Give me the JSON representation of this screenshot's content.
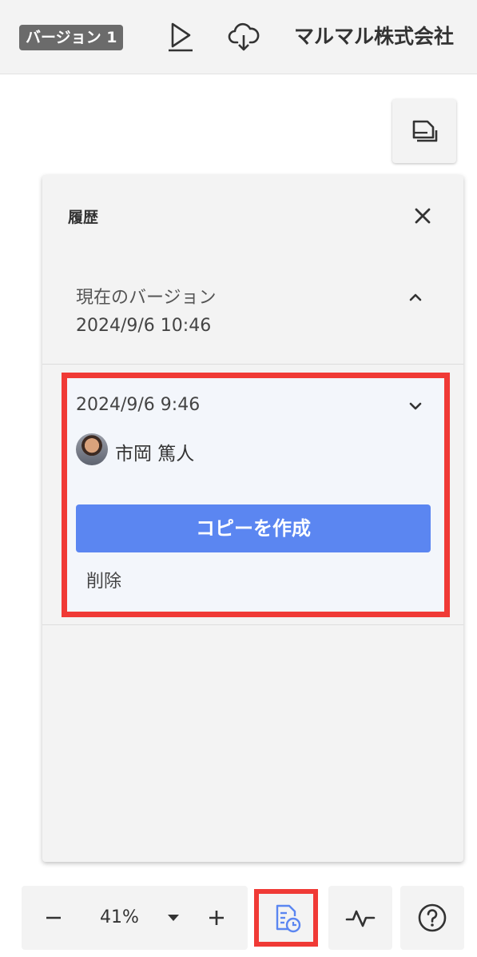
{
  "header": {
    "version_badge": "バージョン 1",
    "company_name": "マルマル株式会社",
    "icons": [
      "play-icon",
      "cloud-download-icon"
    ]
  },
  "page_button_icon": "pages-icon",
  "history_panel": {
    "title": "履歴",
    "close_icon": "close-icon",
    "current": {
      "label": "現在のバージョン",
      "date": "2024/9/6 10:46"
    },
    "entry": {
      "date": "2024/9/6 9:46",
      "user_name": "市岡 篤人",
      "copy_label": "コピーを作成",
      "delete_label": "削除"
    }
  },
  "bottom_bar": {
    "zoom_minus": "−",
    "zoom_value": "41%",
    "zoom_plus": "+",
    "icons": [
      "history-icon",
      "activity-icon",
      "help-icon"
    ]
  },
  "colors": {
    "accent": "#5b86f1",
    "highlight": "#f03a36",
    "panel_bg": "#f3f3f3"
  }
}
